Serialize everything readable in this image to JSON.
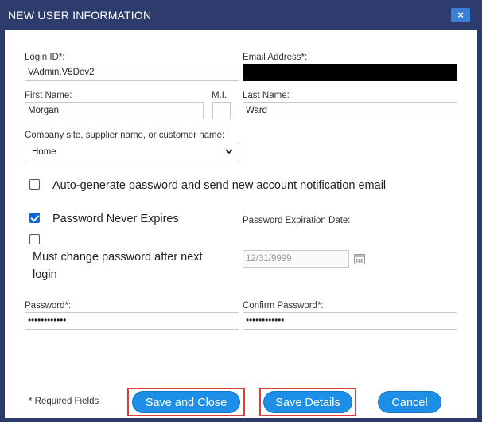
{
  "dialog": {
    "title": "NEW USER INFORMATION",
    "close_label": "×"
  },
  "fields": {
    "login_id": {
      "label": "Login ID*:",
      "value": "VAdmin.V5Dev2"
    },
    "email": {
      "label": "Email Address*:",
      "value": ""
    },
    "first_name": {
      "label": "First Name:",
      "value": "Morgan"
    },
    "mi": {
      "label": "M.I.",
      "value": ""
    },
    "last_name": {
      "label": "Last Name:",
      "value": "Ward"
    },
    "company": {
      "label": "Company site, supplier name, or customer name:",
      "value": "Home"
    },
    "password": {
      "label": "Password*:",
      "value": "••••••••••••"
    },
    "confirm_password": {
      "label": "Confirm Password*:",
      "value": "••••••••••••"
    },
    "expiration_date": {
      "label": "Password Expiration Date:",
      "value": "12/31/9999"
    }
  },
  "options": {
    "auto_generate": {
      "label": "Auto-generate password and send new account notification email",
      "checked": false
    },
    "never_expires": {
      "label": "Password Never Expires",
      "checked": true
    },
    "must_change": {
      "label_line1": "Must change password after next",
      "label_line2": "login",
      "checked": false
    }
  },
  "footer": {
    "required_note": "* Required Fields",
    "save_close_label": "Save and Close",
    "save_details_label": "Save Details",
    "cancel_label": "Cancel"
  },
  "colors": {
    "titlebar": "#2d3c6c",
    "button": "#1e8fe6",
    "highlight": "#e03a3a",
    "checkbox": "#0b63d6"
  },
  "icons": {
    "close": "close-icon",
    "calendar": "calendar-icon",
    "dropdown": "chevron-down-icon"
  }
}
